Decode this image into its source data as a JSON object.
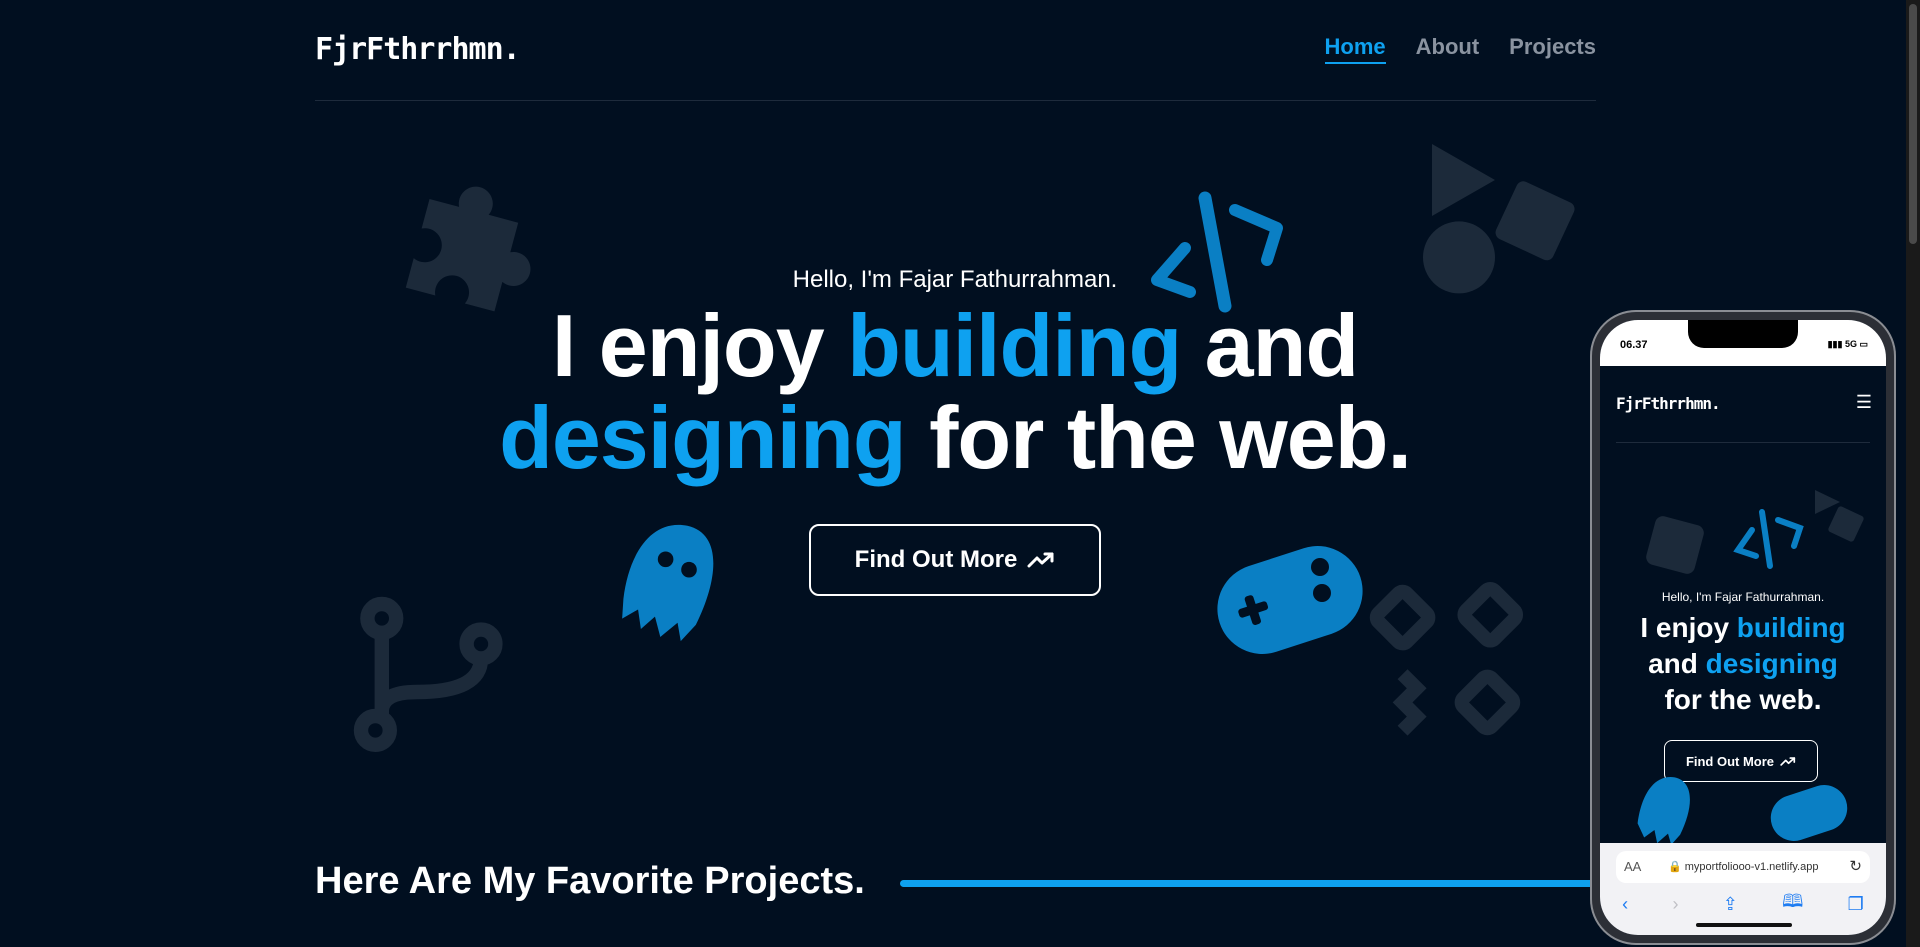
{
  "nav": {
    "logo": "FjrFthrrhmn.",
    "links": [
      {
        "label": "Home",
        "active": true
      },
      {
        "label": "About",
        "active": false
      },
      {
        "label": "Projects",
        "active": false
      }
    ]
  },
  "hero": {
    "hello": "Hello, I'm Fajar Fathurrahman.",
    "line1_a": "I enjoy ",
    "line1_b": "building",
    "line1_c": " and",
    "line2_a": "designing",
    "line2_b": " for the web.",
    "cta_label": "Find Out More"
  },
  "projects": {
    "title": "Here Are My Favorite Projects."
  },
  "phone": {
    "time": "06.37",
    "signal": "5G",
    "logo": "FjrFthrrhmn.",
    "hello": "Hello, I'm Fajar Fathurrahman.",
    "h1_a": "I enjoy ",
    "h1_b": "building",
    "h2_a": "and ",
    "h2_b": "designing",
    "h3": "for the web.",
    "cta_label": "Find Out More",
    "aa": "AA",
    "url": "myportfoliooo-v1.netlify.app"
  },
  "colors": {
    "background": "#010f20",
    "accent": "#0ea1f0",
    "decoration": "#1c2a3a"
  }
}
